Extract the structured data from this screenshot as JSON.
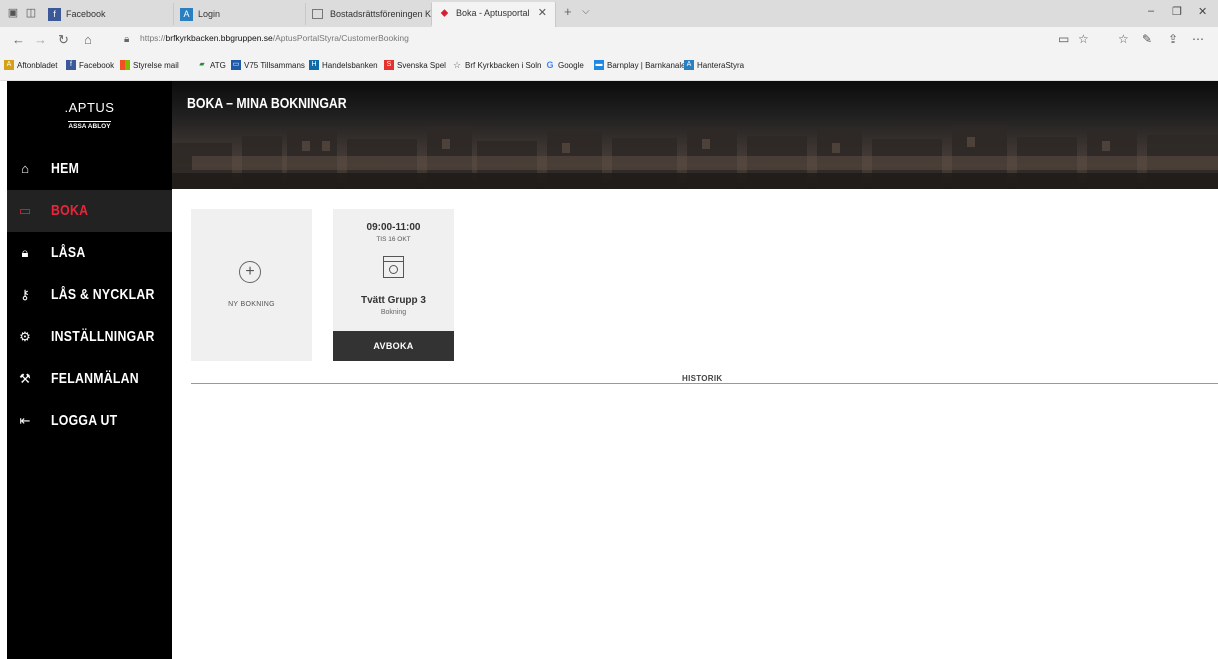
{
  "browser": {
    "tabs": [
      {
        "label": "Facebook",
        "icon": "facebook-icon"
      },
      {
        "label": "Login",
        "icon": "aptus-icon"
      },
      {
        "label": "Bostadsrättsföreningen Kyri",
        "icon": "page-icon"
      },
      {
        "label": "Boka - Aptusportal",
        "icon": "aptus-pin-icon",
        "active": true
      }
    ],
    "url_prefix": "https://",
    "url_host": "brfkyrkbacken.bbgruppen.se",
    "url_path": "/AptusPortalStyra/CustomerBooking",
    "favorites": [
      "Aftonbladet",
      "Facebook",
      "Styrelse mail",
      "ATG",
      "V75 Tillsammans",
      "Handelsbanken",
      "Svenska Spel",
      "Brf Kyrkbacken i Soln",
      "Google",
      "Barnplay | Barnkanale",
      "HanteraStyra"
    ]
  },
  "brand": {
    "name": ".APTUS",
    "sub": "ASSA ABLOY"
  },
  "menu": [
    {
      "label": "HEM",
      "icon": "home-icon"
    },
    {
      "label": "BOKA",
      "icon": "calendar-icon",
      "active": true
    },
    {
      "label": "LÅSA",
      "icon": "lock-icon"
    },
    {
      "label": "LÅS & NYCKLAR",
      "icon": "keys-icon"
    },
    {
      "label": "INSTÄLLNINGAR",
      "icon": "gear-icon"
    },
    {
      "label": "FELANMÄLAN",
      "icon": "tools-icon"
    },
    {
      "label": "LOGGA UT",
      "icon": "logout-icon"
    }
  ],
  "page": {
    "title": "BOKA – MINA BOKNINGAR"
  },
  "new_booking": {
    "label": "NY BOKNING"
  },
  "booking": {
    "time": "09:00-11:00",
    "date": "TIS 16 OKT",
    "name": "Tvätt Grupp 3",
    "type": "Bokning",
    "cancel_label": "AVBOKA"
  },
  "history": {
    "label": "HISTORIK"
  },
  "colors": {
    "accent": "#e8263a",
    "sidebar": "#000000",
    "card": "#f0f0f0",
    "button": "#333333"
  }
}
